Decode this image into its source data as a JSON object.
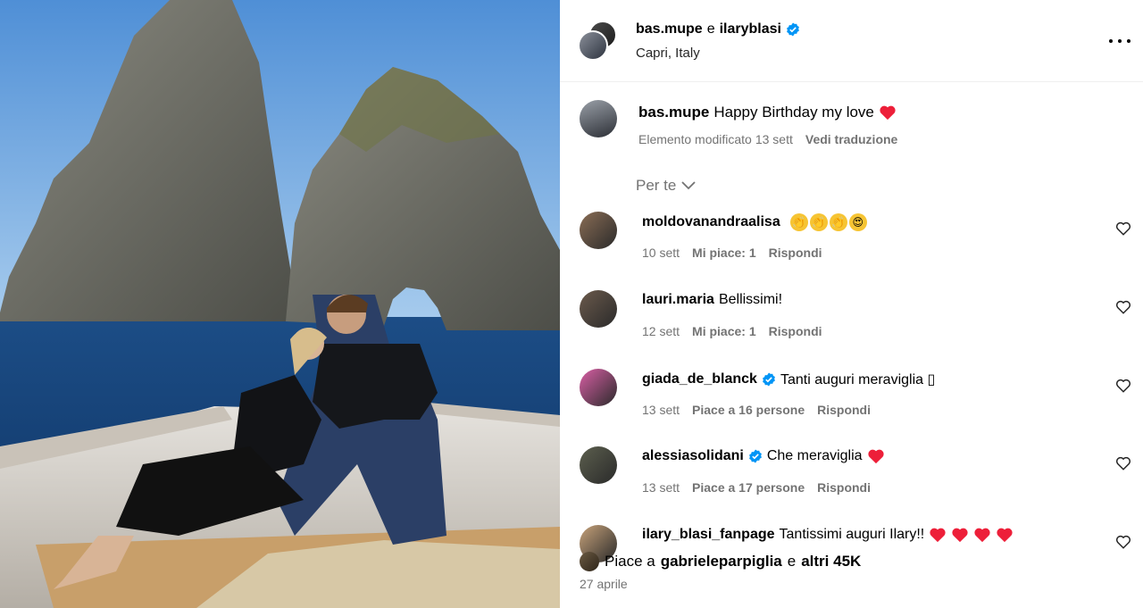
{
  "post": {
    "authors": [
      "bas.mupe",
      "ilaryblasi"
    ],
    "authors_sep": "e",
    "location": "Capri, Italy",
    "caption": {
      "user": "bas.mupe",
      "text": "Happy Birthday my love",
      "status": "Elemento modificato",
      "time": "13 sett",
      "translate": "Vedi traduzione"
    },
    "filter": "Per te",
    "comments": [
      {
        "user": "moldovanandraalisa",
        "verified": false,
        "text": "",
        "emojis": [
          "clap",
          "clap",
          "clap",
          "heart-eyes"
        ],
        "hearts": 0,
        "time": "10 sett",
        "likes": "Mi piace: 1",
        "reply": "Rispondi",
        "avatar_color": "#8a6d55"
      },
      {
        "user": "lauri.maria",
        "verified": false,
        "text": "Bellissimi!",
        "emojis": [],
        "hearts": 0,
        "time": "12 sett",
        "likes": "Mi piace: 1",
        "reply": "Rispondi",
        "avatar_color": "#6b5a4c"
      },
      {
        "user": "giada_de_blanck",
        "verified": true,
        "text": "Tanti auguri meraviglia ▯",
        "emojis": [],
        "hearts": 0,
        "time": "13 sett",
        "likes": "Piace a 16 persone",
        "reply": "Rispondi",
        "avatar_color": "#d95fa5"
      },
      {
        "user": "alessiasolidani",
        "verified": true,
        "text": "Che meraviglia",
        "emojis": [],
        "hearts": 1,
        "time": "13 sett",
        "likes": "Piace a 17 persone",
        "reply": "Rispondi",
        "avatar_color": "#5c5f4e"
      },
      {
        "user": "ilary_blasi_fanpage",
        "verified": false,
        "text": "Tantissimi auguri Ilary!!",
        "emojis": [],
        "hearts": 4,
        "time": "",
        "likes": "",
        "reply": "",
        "avatar_color": "#c7a27a"
      }
    ],
    "likes": {
      "prefix": "Piace a",
      "user": "gabrieleparpiglia",
      "mid": "e",
      "rest": "altri 45K"
    },
    "date": "27 aprile"
  },
  "colors": {
    "verified": "#0095f6",
    "heart": "#ed1f39",
    "muted": "#737373"
  }
}
